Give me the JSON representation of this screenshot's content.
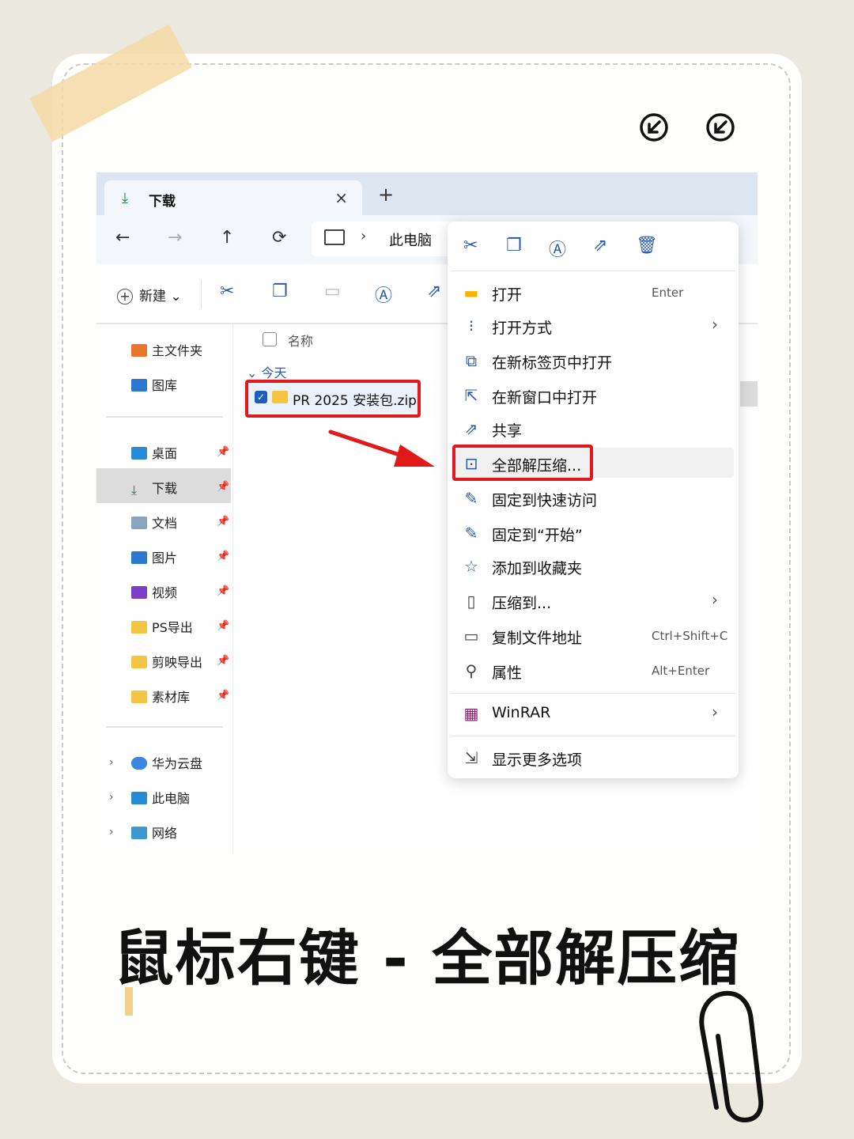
{
  "explorer": {
    "tab_title": "下载",
    "tab_close": "×",
    "tab_add": "+",
    "nav": {
      "back": "←",
      "forward": "→",
      "up": "↑",
      "refresh": "⟳"
    },
    "address": {
      "chevron": "›",
      "location": "此电脑"
    },
    "toolbar": {
      "new_label": "新建",
      "new_plus": "+",
      "new_caret": "⌄"
    },
    "sidebar": {
      "top": [
        {
          "label": "主文件夹",
          "icon": "home-icon"
        },
        {
          "label": "图库",
          "icon": "gallery-icon"
        }
      ],
      "quick": [
        {
          "label": "桌面",
          "icon": "desktop-icon"
        },
        {
          "label": "下载",
          "icon": "download-icon"
        },
        {
          "label": "文档",
          "icon": "document-icon"
        },
        {
          "label": "图片",
          "icon": "pictures-icon"
        },
        {
          "label": "视频",
          "icon": "video-icon"
        },
        {
          "label": "PS导出",
          "icon": "folder-icon"
        },
        {
          "label": "剪映导出",
          "icon": "folder-icon"
        },
        {
          "label": "素材库",
          "icon": "folder-icon"
        }
      ],
      "pin": "📌",
      "drives": [
        {
          "label": "华为云盘",
          "icon": "cloud-icon"
        },
        {
          "label": "此电脑",
          "icon": "pc-icon"
        },
        {
          "label": "网络",
          "icon": "network-icon"
        }
      ],
      "expand": "›"
    },
    "content": {
      "column_name": "名称",
      "group_label": "今天",
      "group_caret": "⌄",
      "file_name": "PR 2025 安装包.zip",
      "file_check": "✓"
    }
  },
  "context_menu": {
    "items": [
      {
        "label": "打开",
        "shortcut": "Enter",
        "icon": "folder-open-icon"
      },
      {
        "label": "打开方式",
        "submenu": "›",
        "icon": "open-with-icon"
      },
      {
        "label": "在新标签页中打开",
        "icon": "new-tab-icon"
      },
      {
        "label": "在新窗口中打开",
        "icon": "new-window-icon"
      },
      {
        "label": "共享",
        "icon": "share-icon"
      },
      {
        "label": "全部解压缩...",
        "icon": "extract-icon"
      },
      {
        "label": "固定到快速访问",
        "icon": "pin-icon"
      },
      {
        "label": "固定到“开始”",
        "icon": "pin-start-icon"
      },
      {
        "label": "添加到收藏夹",
        "icon": "star-icon"
      },
      {
        "label": "压缩到...",
        "submenu": "›",
        "icon": "compress-icon"
      },
      {
        "label": "复制文件地址",
        "shortcut": "Ctrl+Shift+C",
        "icon": "copy-path-icon"
      },
      {
        "label": "属性",
        "shortcut": "Alt+Enter",
        "icon": "wrench-icon"
      },
      {
        "label": "WinRAR",
        "submenu": "›",
        "icon": "winrar-icon"
      },
      {
        "label": "显示更多选项",
        "icon": "more-options-icon"
      }
    ]
  },
  "caption": "鼠标右键 - 全部解压缩",
  "colors": {
    "highlight_red": "#e0191b",
    "accent_blue": "#2a5aa8",
    "tape": "#f6d9a6"
  }
}
